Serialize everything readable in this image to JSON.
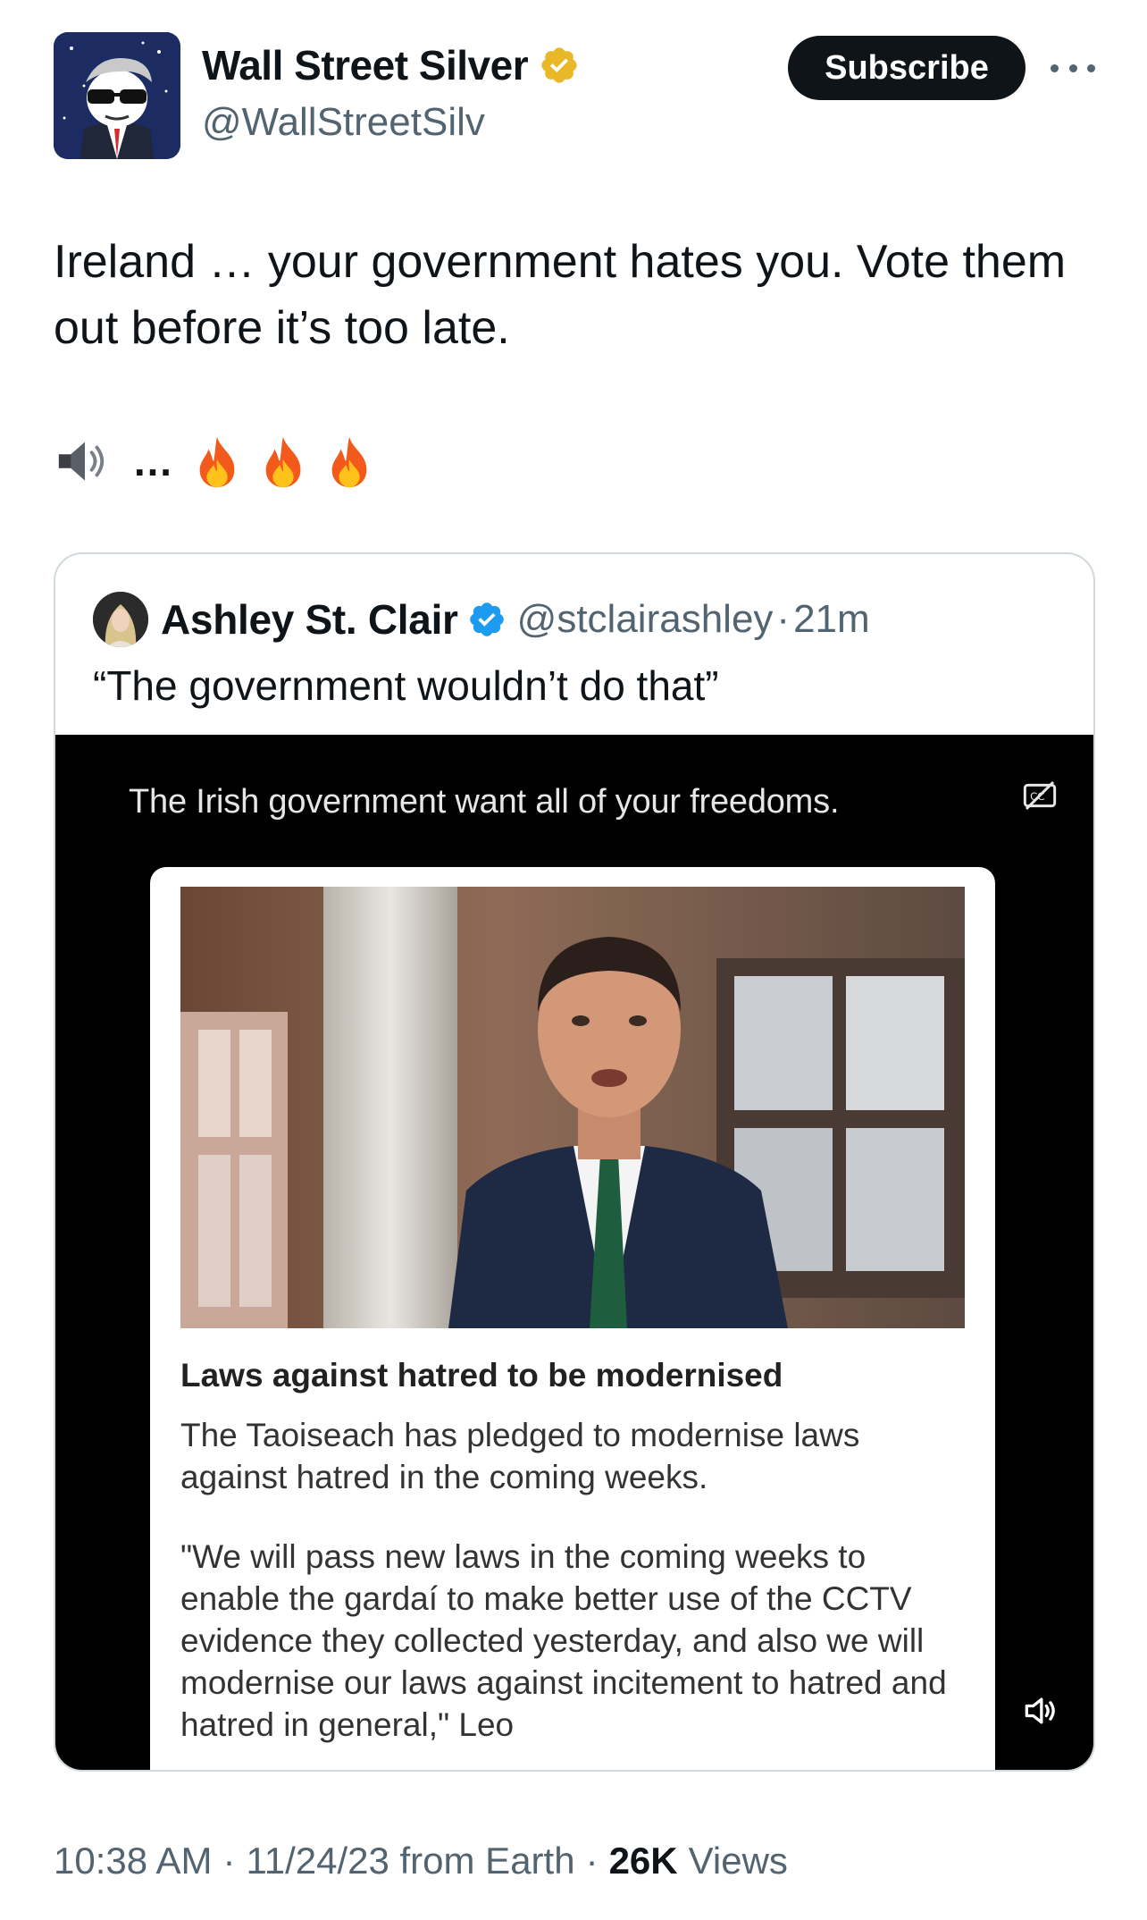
{
  "author": {
    "display_name": "Wall Street Silver",
    "handle": "@WallStreetSilv",
    "subscribe_label": "Subscribe"
  },
  "tweet": {
    "text": "Ireland … your government hates you. Vote them out before it’s too late.",
    "emoji_line": {
      "speaker": "speaker-emoji",
      "ellipsis": "…",
      "fire": [
        "fire-emoji",
        "fire-emoji",
        "fire-emoji"
      ]
    }
  },
  "quote": {
    "display_name": "Ashley St. Clair",
    "handle": "@stclairashley",
    "separator": "·",
    "time": "21m",
    "text": "“The government wouldn’t do that”",
    "video": {
      "caption": "The Irish government want all of your freedoms.",
      "article_title": "Laws against hatred to be modernised",
      "article_para1": "The Taoiseach has pledged to modernise laws against hatred in the coming weeks.",
      "article_para2": "\"We will pass new laws in the coming weeks to enable the gardaí to make better use of the CCTV evidence they collected yesterday, and also we will modernise our laws against incitement to hatred and hatred in general,\" Leo"
    }
  },
  "footer": {
    "time": "10:38 AM",
    "sep1": "·",
    "date_source": "11/24/23 from Earth",
    "sep2": "·",
    "views_count": "26K",
    "views_label": "Views"
  },
  "colors": {
    "text_primary": "#0f1419",
    "text_secondary": "#536471",
    "verified_gold": "#e8b829",
    "verified_blue": "#1d9bf0",
    "subscribe_bg": "#0f1419",
    "border": "#cfd9de"
  }
}
